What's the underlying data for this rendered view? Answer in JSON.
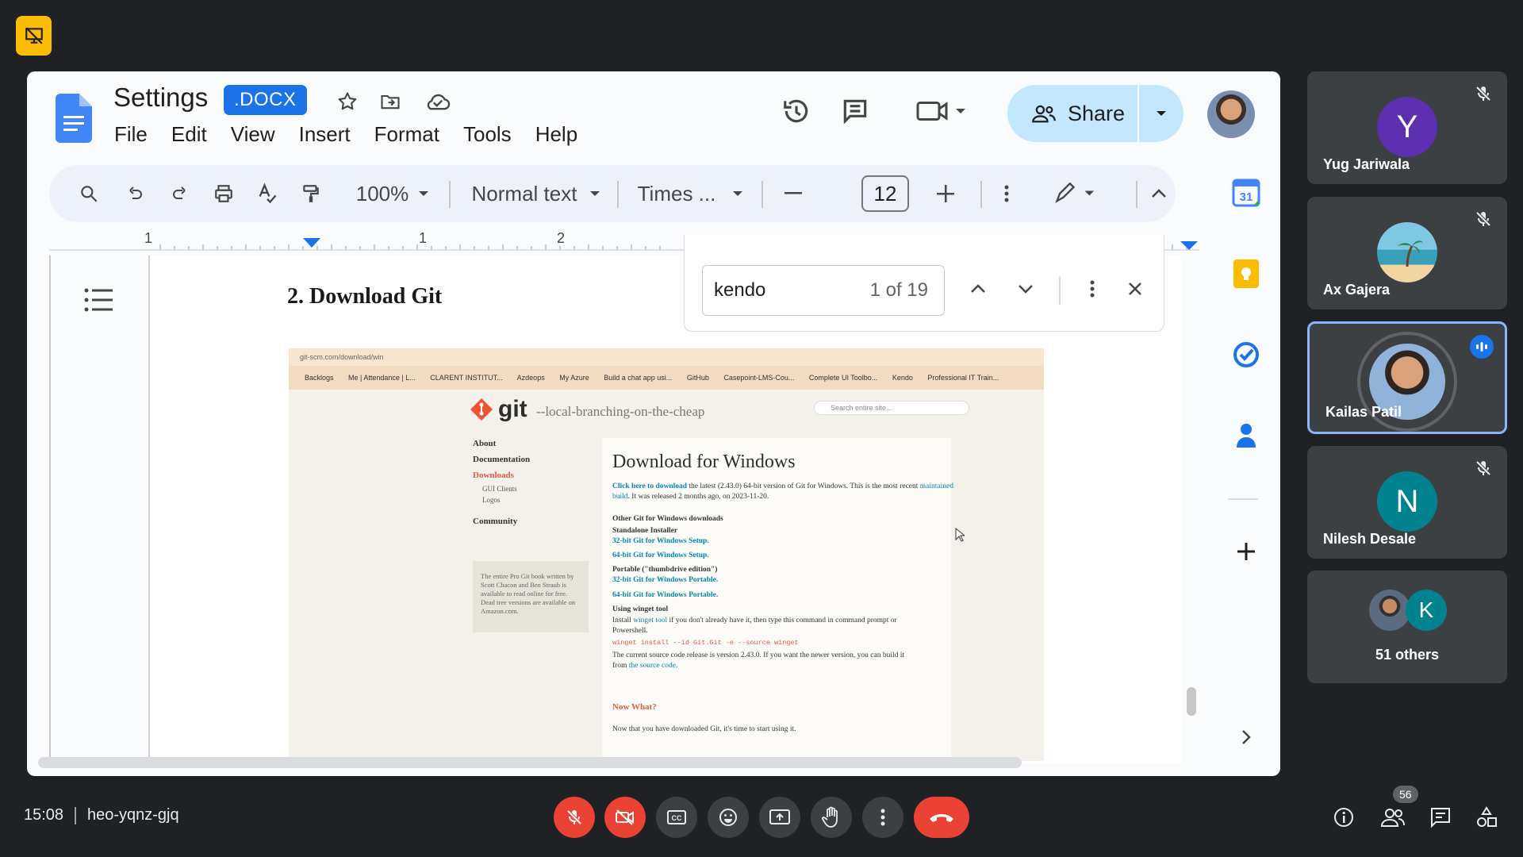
{
  "meeting": {
    "time": "15:08",
    "code": "heo-yqnz-gjq",
    "participant_count": "56"
  },
  "doc": {
    "title": "Settings",
    "badge": ".DOCX",
    "menu": [
      "File",
      "Edit",
      "View",
      "Insert",
      "Format",
      "Tools",
      "Help"
    ],
    "share_label": "Share",
    "toolbar": {
      "zoom": "100%",
      "style": "Normal text",
      "font": "Times ...",
      "font_size": "12"
    },
    "ruler_labels": [
      "1",
      "1",
      "2"
    ],
    "heading": "2. Download Git",
    "find": {
      "query": "kendo",
      "count": "1 of 19"
    }
  },
  "embedded_page": {
    "url": "git-scm.com/download/win",
    "bookmarks": [
      "Backlogs",
      "Me | Attendance | L...",
      "CLARENT INSTITUT...",
      "Azdeops",
      "My Azure",
      "Build a chat app usi...",
      "GitHub",
      "Casepoint-LMS-Cou...",
      "Complete UI Toolbo...",
      "Kendo",
      "Professional IT Train..."
    ],
    "logo": "git",
    "tagline": "--local-branching-on-the-cheap",
    "search_placeholder": "Search entire site...",
    "nav": [
      "About",
      "Documentation",
      "Downloads",
      "GUI Clients",
      "Logos",
      "Community"
    ],
    "book_text": "The entire Pro Git book written by Scott Chacon and Ben Straub is available to read online for free. Dead tree versions are available on Amazon.com.",
    "heading": "Download for Windows",
    "intro_link": "Click here to download",
    "intro": " the latest (2.43.0) 64-bit version of Git for Windows. This is the most recent ",
    "intro_link2": "maintained build",
    "intro_end": ". It was released 2 months ago, on 2023-11-20.",
    "other_heading": "Other Git for Windows downloads",
    "standalone": "Standalone Installer",
    "link_32_setup": "32-bit Git for Windows Setup.",
    "link_64_setup": "64-bit Git for Windows Setup.",
    "portable": "Portable (\"thumbdrive edition\")",
    "link_32_portable": "32-bit Git for Windows Portable.",
    "link_64_portable": "64-bit Git for Windows Portable.",
    "winget_heading": "Using winget tool",
    "winget_text_1": "Install ",
    "winget_link": "winget tool",
    "winget_text_2": " if you don't already have it, then type this command in command prompt or Powershell.",
    "winget_cmd": "winget install --id Git.Git -e --source winget",
    "source_text": "The current source code release is version 2.43.0. If you want the newer version, you can build it from ",
    "source_link": "the source code",
    "source_end": ".",
    "now_what": "Now What?",
    "now_what_text": "Now that you have downloaded Git, it's time to start using it."
  },
  "participants": [
    {
      "name": "Yug Jariwala",
      "initial": "Y",
      "color": "#5b2fb0",
      "muted": true
    },
    {
      "name": "Ax Gajera",
      "initial": "",
      "color": "#4cb8c9",
      "muted": true
    },
    {
      "name": "Kailas Patil",
      "initial": "",
      "color": "#6e5a4c",
      "muted": false,
      "speaking": true
    },
    {
      "name": "Nilesh Desale",
      "initial": "N",
      "color": "#00838f",
      "muted": true
    }
  ],
  "others": {
    "label": "51 others",
    "initial": "K",
    "color": "#00838f"
  },
  "colors": {
    "accent": "#1a73e8",
    "end_call": "#ea4335",
    "share_bg": "#c2e7ff",
    "badge_yellow": "#fbbc04"
  }
}
